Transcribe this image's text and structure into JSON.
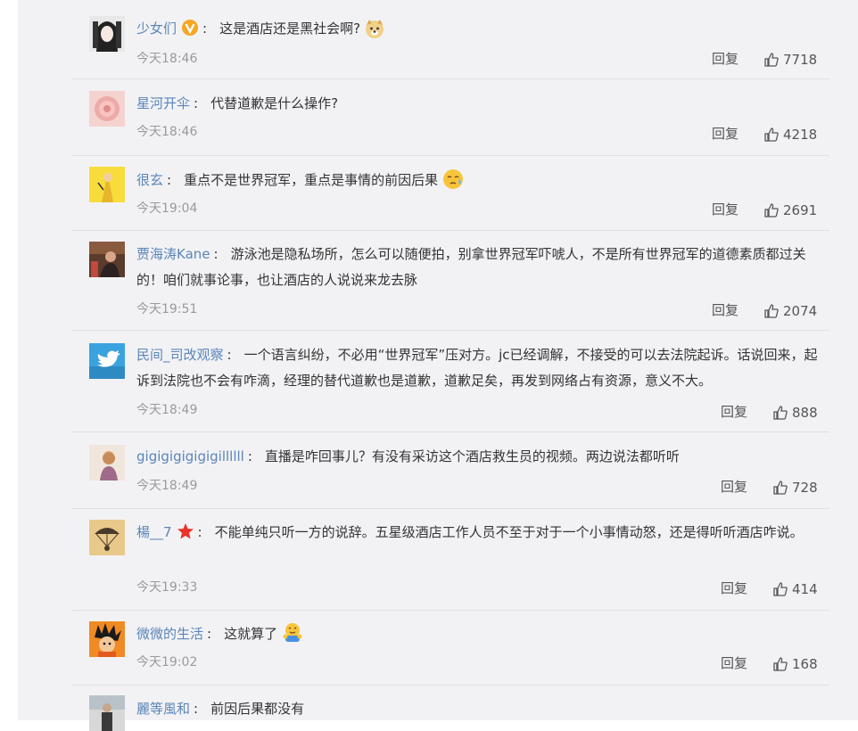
{
  "reply_label": "回复",
  "comments": [
    {
      "user": "少女们",
      "badge": "v-icon",
      "text": "这是酒店还是黑社会啊?",
      "emoji": "doge",
      "time": "今天18:46",
      "likes": "7718"
    },
    {
      "user": "星河开伞",
      "text": "代替道歉是什么操作?",
      "time": "今天18:46",
      "likes": "4218"
    },
    {
      "user": "很玄",
      "text": "重点不是世界冠军，重点是事情的前因后果",
      "emoji": "sweat-face",
      "time": "今天19:04",
      "likes": "2691"
    },
    {
      "user": "贾海涛Kane",
      "text": "游泳池是隐私场所，怎么可以随便拍，别拿世界冠军吓唬人，不是所有世界冠军的道德素质都过关的！咱们就事论事，也让酒店的人说说来龙去脉",
      "time": "今天19:51",
      "likes": "2074"
    },
    {
      "user": "民间_司改观察",
      "text": "一个语言纠纷，不必用“世界冠军”压对方。jc已经调解，不接受的可以去法院起诉。话说回来，起诉到法院也不会有咋滴，经理的替代道歉也是道歉，道歉足矣，再发到网络占有资源，意义不大。",
      "time": "今天18:49",
      "likes": "888"
    },
    {
      "user": "gigigigigigigillllll",
      "text": "直播是咋回事儿？有没有采访这个酒店救生员的视频。两边说法都听听",
      "time": "今天18:49",
      "likes": "728"
    },
    {
      "user": "楊__7",
      "badge": "star-icon",
      "text": "不能单纯只听一方的说辞。五星级酒店工作人员不至于对于一个小事情动怒，还是得听听酒店咋说。",
      "time": "今天19:33",
      "likes": "414"
    },
    {
      "user": "微微的生活",
      "text": "这就算了",
      "emoji": "hug",
      "time": "今天19:02",
      "likes": "168"
    },
    {
      "user": "麗等風和",
      "text": "前因后果都没有"
    }
  ],
  "colors": {
    "username": "#5b85b8",
    "text": "#333333",
    "meta": "#9a9a9a",
    "panel": "#f2f2f5"
  }
}
